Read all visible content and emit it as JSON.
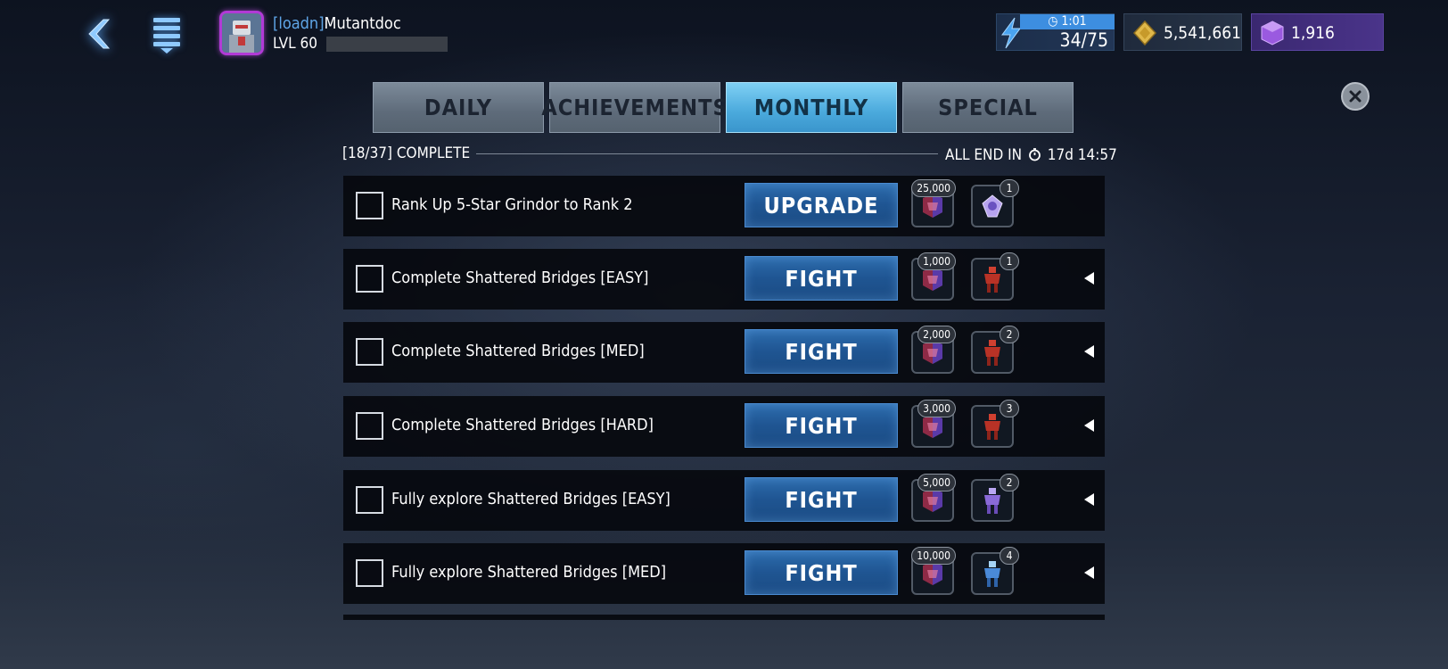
{
  "header": {
    "player_tag": "[loadn]",
    "player_name": "Mutantdoc",
    "level_label": "LVL 60",
    "energy_timer": "1:01",
    "energy_value": "34/75",
    "gold": "5,541,661",
    "units": "1,916"
  },
  "tabs": [
    {
      "label": "DAILY",
      "active": false
    },
    {
      "label": "ACHIEVEMENTS",
      "active": false
    },
    {
      "label": "MONTHLY",
      "active": true
    },
    {
      "label": "SPECIAL",
      "active": false
    }
  ],
  "summary": {
    "progress": "[18/37] COMPLETE",
    "end_prefix": "ALL END IN",
    "end_time": "17d 14:57"
  },
  "missions": [
    {
      "label": "Rank Up 5-Star Grindor to Rank 2",
      "action": "UPGRADE",
      "reward1_count": "25,000",
      "reward2_count": "1",
      "reward2_icon": "crystal-shard-icon",
      "has_expand": false
    },
    {
      "label": "Complete Shattered Bridges [EASY]",
      "action": "FIGHT",
      "reward1_count": "1,000",
      "reward2_count": "1",
      "reward2_icon": "red-bot-icon",
      "has_expand": true
    },
    {
      "label": "Complete Shattered Bridges [MED]",
      "action": "FIGHT",
      "reward1_count": "2,000",
      "reward2_count": "2",
      "reward2_icon": "red-bot-icon",
      "has_expand": true
    },
    {
      "label": "Complete Shattered Bridges [HARD]",
      "action": "FIGHT",
      "reward1_count": "3,000",
      "reward2_count": "3",
      "reward2_icon": "red-bot-icon",
      "has_expand": true
    },
    {
      "label": "Fully explore Shattered Bridges [EASY]",
      "action": "FIGHT",
      "reward1_count": "5,000",
      "reward2_count": "2",
      "reward2_icon": "purple-bot-icon",
      "has_expand": true
    },
    {
      "label": "Fully explore Shattered Bridges [MED]",
      "action": "FIGHT",
      "reward1_count": "10,000",
      "reward2_count": "4",
      "reward2_icon": "blue-bot-icon",
      "has_expand": true
    }
  ],
  "colors": {
    "active_tab": "#4aa9dc",
    "action_button": "#1f5592",
    "units_box": "#4a348a"
  }
}
